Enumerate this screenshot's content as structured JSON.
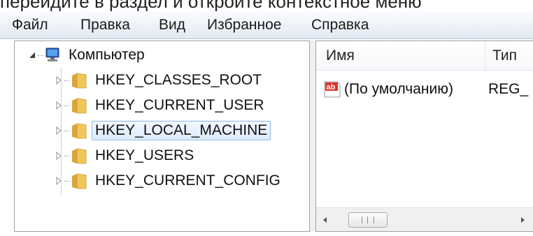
{
  "top_caption": "перейдите в раздел и откройте контекстное меню",
  "menu": {
    "items": [
      "Файл",
      "Правка",
      "Вид",
      "Избранное",
      "Справка"
    ]
  },
  "tree": {
    "root": {
      "label": "Компьютер",
      "icon": "computer-icon"
    },
    "children": [
      {
        "label": "HKEY_CLASSES_ROOT",
        "icon": "folder-icon",
        "selected": false
      },
      {
        "label": "HKEY_CURRENT_USER",
        "icon": "folder-icon",
        "selected": false
      },
      {
        "label": "HKEY_LOCAL_MACHINE",
        "icon": "folder-icon",
        "selected": true
      },
      {
        "label": "HKEY_USERS",
        "icon": "folder-icon",
        "selected": false
      },
      {
        "label": "HKEY_CURRENT_CONFIG",
        "icon": "folder-icon",
        "selected": false
      }
    ]
  },
  "values_pane": {
    "columns": [
      "Имя",
      "Тип"
    ],
    "rows": [
      {
        "name": "(По умолчанию)",
        "type": "REG_",
        "icon": "string-value-icon"
      }
    ]
  },
  "scrollbar": {
    "thumb_glyph": "III"
  },
  "colors": {
    "selection_fill": "#dcebfb",
    "selection_border": "#8fb8e8",
    "folder": "#f2c75a",
    "menubar": "#e3e9f2"
  }
}
